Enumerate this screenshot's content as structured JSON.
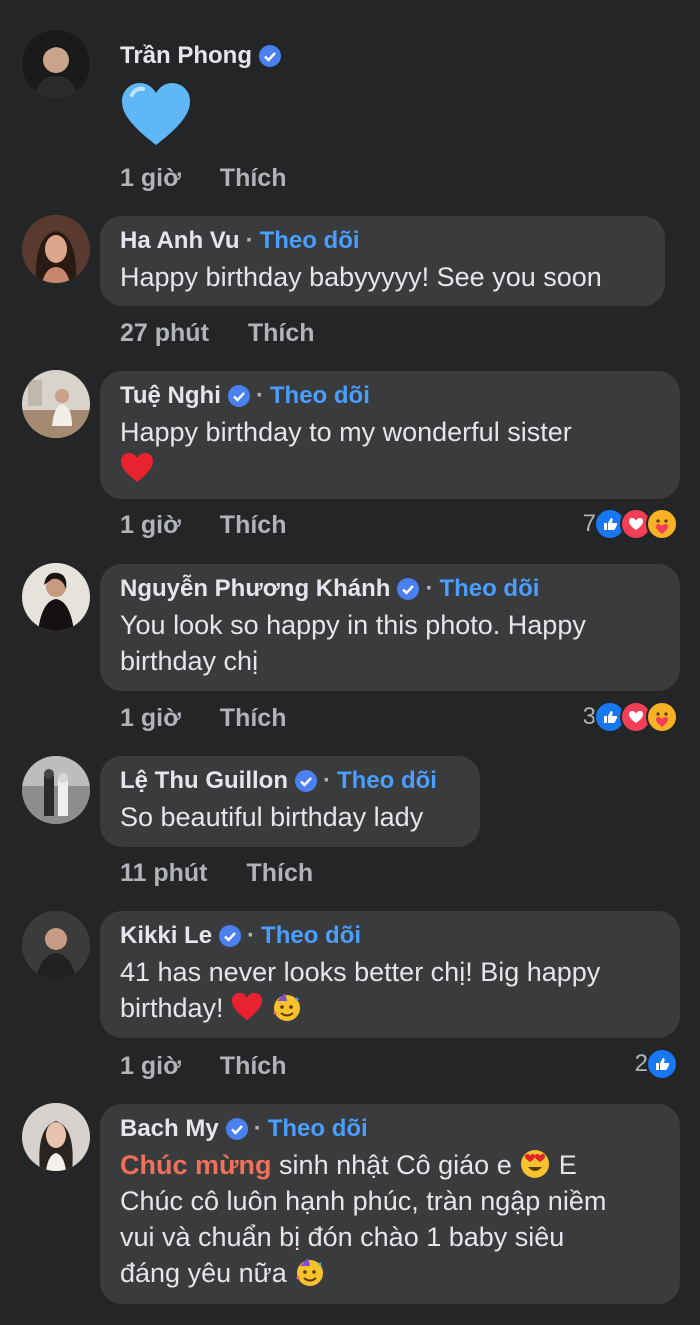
{
  "comments": [
    {
      "name": "Trần Phong",
      "verified": true,
      "text": "",
      "time": "1 giờ",
      "like": "Thích"
    },
    {
      "name": "Ha Anh Vu",
      "follow": "Theo dõi",
      "text": "Happy birthday babyyyyy! See you soon",
      "time": "27 phút",
      "like": "Thích"
    },
    {
      "name": "Tuệ Nghi",
      "verified": true,
      "follow": "Theo dõi",
      "text": "Happy birthday to my wonderful sister",
      "time": "1 giờ",
      "like": "Thích",
      "reactions": "7"
    },
    {
      "name": "Nguyễn Phương Khánh",
      "verified": true,
      "follow": "Theo dõi",
      "text_line1": "You look so happy in this photo. Happy",
      "text_line2": "birthday chị",
      "time": "1 giờ",
      "like": "Thích",
      "reactions": "3"
    },
    {
      "name": "Lệ Thu Guillon",
      "verified": true,
      "follow": "Theo dõi",
      "text": "So beautiful birthday lady",
      "time": "11 phút",
      "like": "Thích"
    },
    {
      "name": "Kikki Le",
      "verified": true,
      "follow": "Theo dõi",
      "text_line1": "41 has never looks better chị! Big happy",
      "text_line2": "birthday!",
      "time": "1 giờ",
      "like": "Thích",
      "reactions": "2"
    },
    {
      "name": "Bach My",
      "verified": true,
      "follow": "Theo dõi",
      "highlight": "Chúc mừng",
      "text_line1_rest": " sinh nhật Cô giáo e ",
      "text_line1_end": " E",
      "text_line2": "Chúc cô luôn hạnh phúc, tràn ngập niềm",
      "text_line3": "vui và chuẩn bị đón chào 1 baby siêu",
      "text_line4": "đáng yêu nữa "
    }
  ],
  "separator": "·",
  "colors": {
    "background": "#242526",
    "bubble": "#3a3b3c",
    "follow": "#4a9eff",
    "highlight": "#f0705a",
    "verified": "#4a80f0"
  }
}
